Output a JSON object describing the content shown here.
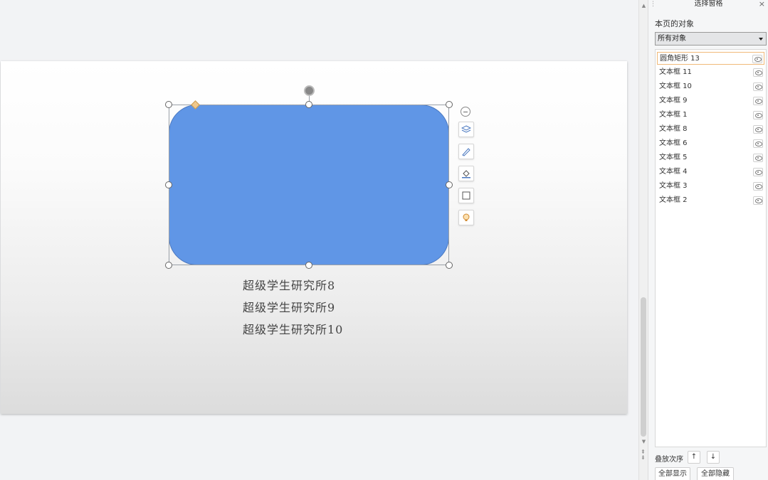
{
  "slide": {
    "text_lines": [
      "超级学生研究所8",
      "超级学生研究所9",
      "超级学生研究所10"
    ],
    "shape_color": "#6096e6"
  },
  "floating_toolbar": {
    "icons": [
      "layers-icon",
      "brush-icon",
      "fill-icon",
      "outline-icon",
      "lightbulb-icon"
    ]
  },
  "pane": {
    "title": "选择窗格",
    "close_glyph": "×",
    "objects_label": "本页的对象",
    "filter_value": "所有对象",
    "items": [
      {
        "label": "圆角矩形 13",
        "selected": true
      },
      {
        "label": "文本框 11"
      },
      {
        "label": "文本框 10"
      },
      {
        "label": "文本框 9"
      },
      {
        "label": "文本框 1"
      },
      {
        "label": "文本框 8"
      },
      {
        "label": "文本框 6"
      },
      {
        "label": "文本框 5"
      },
      {
        "label": "文本框 4"
      },
      {
        "label": "文本框 3"
      },
      {
        "label": "文本框 2"
      }
    ],
    "order_label": "叠放次序",
    "up_glyph": "↑",
    "down_glyph": "↓",
    "show_all": "全部显示",
    "hide_all": "全部隐藏"
  },
  "colors": {
    "selection_accent": "#f0b979",
    "shape_fill": "#6096e6"
  }
}
